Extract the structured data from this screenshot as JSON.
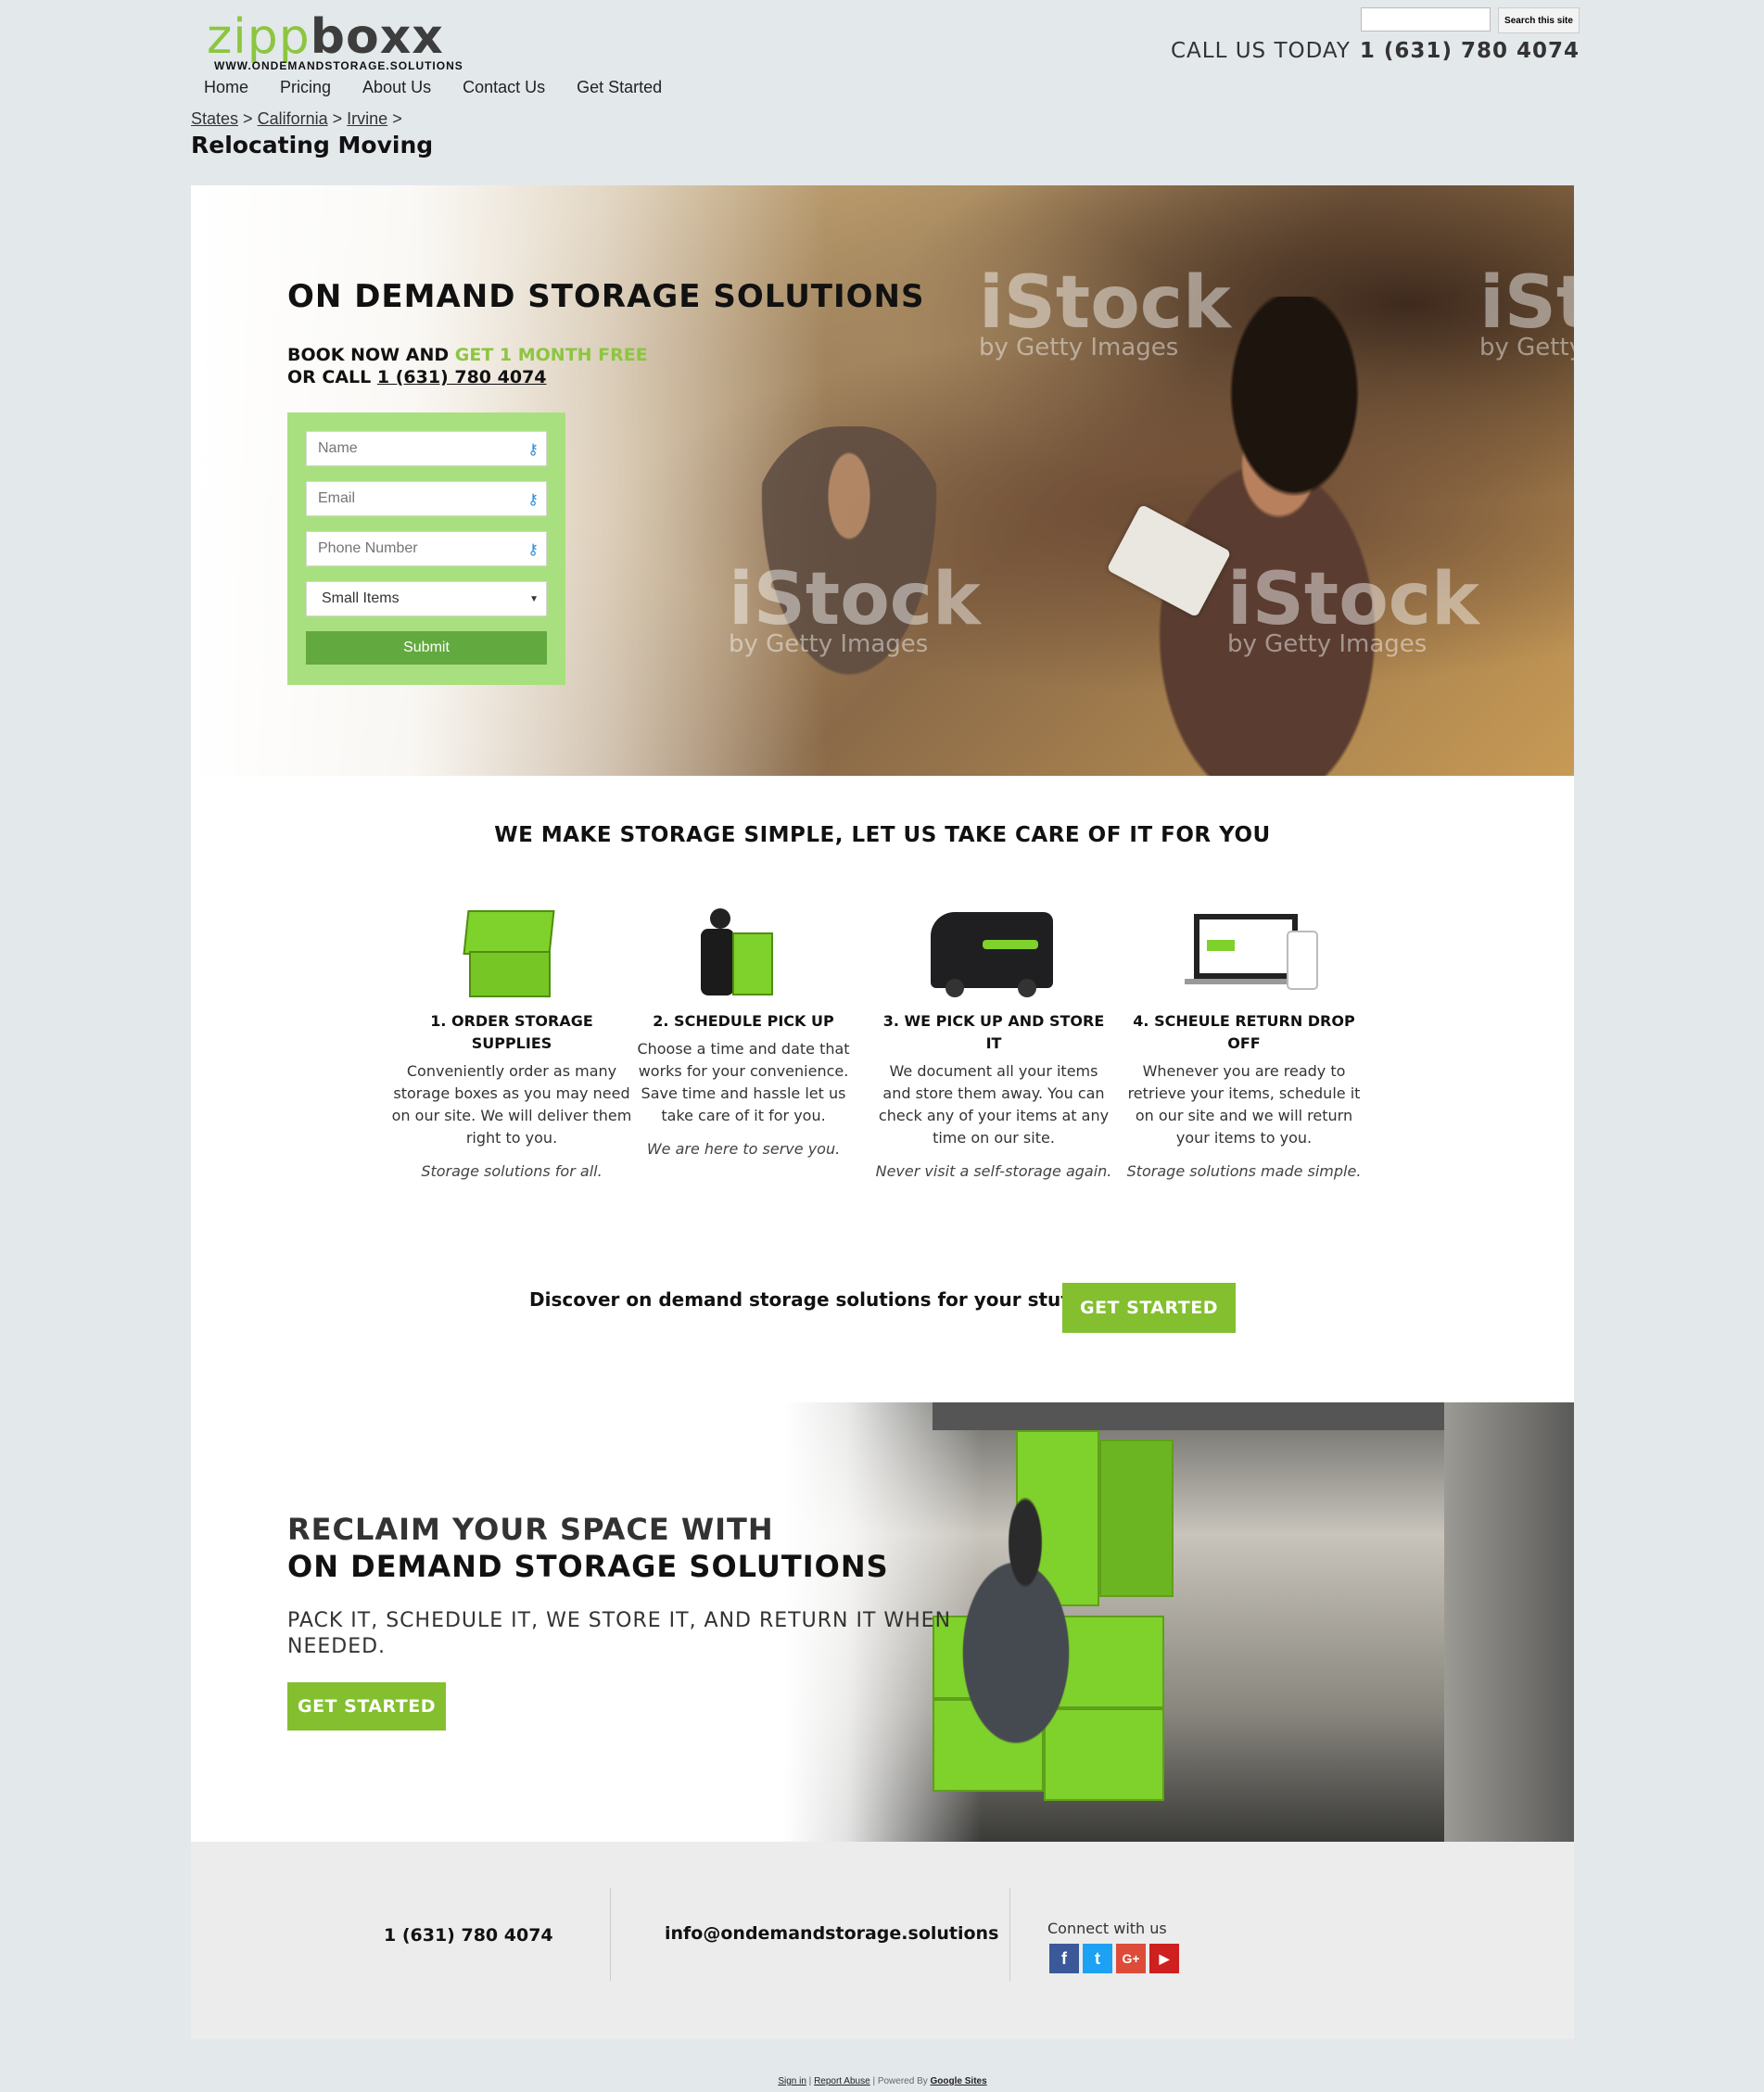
{
  "header": {
    "logo_part1": "zipp",
    "logo_part2": "boxx",
    "logo_url": "WWW.ONDEMANDSTORAGE.SOLUTIONS",
    "search_button": "Search this site",
    "call_label": "CALL US TODAY",
    "call_number": "1 (631) 780 4074"
  },
  "nav": [
    "Home",
    "Pricing",
    "About Us",
    "Contact Us",
    "Get Started"
  ],
  "breadcrumb": {
    "items": [
      "States",
      "California",
      "Irvine"
    ],
    "sep": ">"
  },
  "page_title": "Relocating Moving",
  "hero": {
    "title": "ON DEMAND STORAGE SOLUTIONS",
    "book_prefix": "BOOK NOW AND ",
    "book_highlight": "GET 1 MONTH FREE",
    "or_call_prefix": "OR CALL ",
    "or_call_number": "1 (631) 780 4074",
    "watermark": "iStock",
    "watermark_sub": "by Getty Images",
    "form": {
      "name_placeholder": "Name",
      "email_placeholder": "Email",
      "phone_placeholder": "Phone Number",
      "select_value": "Small Items",
      "submit": "Submit"
    }
  },
  "simple_heading": "WE MAKE STORAGE SIMPLE, LET US TAKE CARE OF IT FOR YOU",
  "steps": [
    {
      "title": "1. ORDER STORAGE SUPPLIES",
      "body": "Conveniently order as many storage boxes as you may need on our site. We will deliver them right to you.",
      "tag": "Storage solutions for all.",
      "icon": "green-crates-icon"
    },
    {
      "title": "2. SCHEDULE PICK UP",
      "body": "Choose a time and date that works for your convenience. Save time and hassle let us take care of it for you.",
      "tag": "We are here to serve you.",
      "icon": "mover-handtruck-icon"
    },
    {
      "title": "3. WE PICK UP AND STORE IT",
      "body": "We document all your items and store them away. You can check any of your items at any time on our site.",
      "tag": "Never visit a self-storage again.",
      "icon": "delivery-van-icon"
    },
    {
      "title": "4. SCHEULE RETURN DROP OFF",
      "body": "Whenever you are ready to retrieve your items, schedule it on our site and we will return your items to you.",
      "tag": "Storage solutions made simple.",
      "icon": "devices-icon"
    }
  ],
  "discover": {
    "text": "Discover on demand storage solutions for your stuff?",
    "button": "GET STARTED"
  },
  "reclaim": {
    "line1": "RECLAIM YOUR SPACE WITH",
    "line2": "ON DEMAND STORAGE SOLUTIONS",
    "sub": "PACK IT, SCHEDULE IT, WE STORE IT, AND RETURN IT WHEN NEEDED.",
    "button": "GET STARTED"
  },
  "footer": {
    "phone": "1 (631) 780 4074",
    "email": "info@ondemandstorage.solutions",
    "connect": "Connect with us",
    "social": [
      "facebook-icon",
      "twitter-icon",
      "google-plus-icon",
      "youtube-icon"
    ]
  },
  "bottom": {
    "sign_in": "Sign in",
    "report": "Report Abuse",
    "powered": "Powered By",
    "google_sites": "Google Sites"
  },
  "colors": {
    "green": "#8cc63f",
    "button_green": "#83bf2f",
    "form_green": "#a9e07f",
    "submit_green": "#62a93f"
  }
}
